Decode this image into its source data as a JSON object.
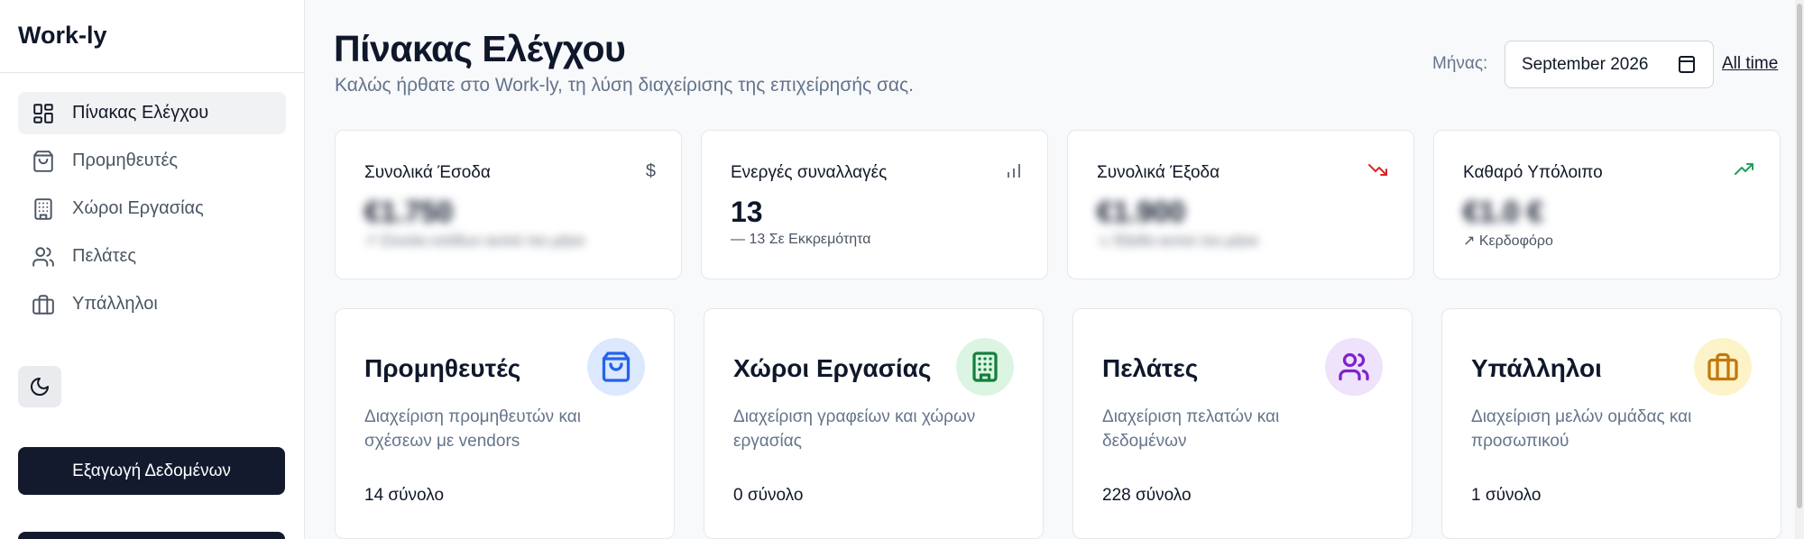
{
  "app": {
    "name": "Work-ly"
  },
  "sidebar": {
    "items": [
      {
        "label": "Πίνακας Ελέγχου",
        "icon": "dashboard-icon",
        "active": true
      },
      {
        "label": "Προμηθευτές",
        "icon": "shopping-bag-icon",
        "active": false
      },
      {
        "label": "Χώροι Εργασίας",
        "icon": "building-icon",
        "active": false
      },
      {
        "label": "Πελάτες",
        "icon": "users-icon",
        "active": false
      },
      {
        "label": "Υπάλληλοι",
        "icon": "briefcase-icon",
        "active": false
      }
    ],
    "theme_icon": "moon-icon",
    "export_label": "Εξαγωγή Δεδομένων"
  },
  "header": {
    "title": "Πίνακας Ελέγχου",
    "subtitle": "Καλώς ήρθατε στο Work-ly, τη λύση διαχείρισης της επιχείρησής σας.",
    "month_label": "Μήνας:",
    "month_value": "September 2026",
    "all_time_label": "All time"
  },
  "stats": [
    {
      "label": "Συνολικά Έσοδα",
      "icon": "dollar-icon",
      "value": "€1.750",
      "sub": "↗ Σύνολο εσόδων αυτού του μήνα",
      "sub_color": "#22a05a",
      "blurred": true
    },
    {
      "label": "Ενεργές συναλλαγές",
      "icon": "bar-chart-icon",
      "value": "13",
      "sub": "— 13 Σε Εκκρεμότητα",
      "sub_color": "#4b5563",
      "blurred": false
    },
    {
      "label": "Συνολικά Έξοδα",
      "icon": "trend-down-icon",
      "value": "€1.900",
      "sub": "↘ Έξοδα αυτού του μήνα",
      "sub_color": "#dc2626",
      "blurred": true
    },
    {
      "label": "Καθαρό Υπόλοιπο",
      "icon": "trend-up-icon",
      "value": "€1.0 €",
      "sub": "↗ Κερδοφόρο",
      "sub_color": "#22a05a",
      "blurred": true
    }
  ],
  "features": [
    {
      "title": "Προμηθευτές",
      "desc": "Διαχείριση προμηθευτών και σχέσεων με vendors",
      "count": "14 σύνολο",
      "icon": "shopping-bag-icon",
      "bg": "#dbe8fd",
      "fg": "#2563eb"
    },
    {
      "title": "Χώροι Εργασίας",
      "desc": "Διαχείριση γραφείων και χώρων εργασίας",
      "count": "0 σύνολο",
      "icon": "building-icon",
      "bg": "#dcf5e3",
      "fg": "#15803d"
    },
    {
      "title": "Πελάτες",
      "desc": "Διαχείριση πελατών και δεδομένων",
      "count": "228 σύνολο",
      "icon": "users-icon",
      "bg": "#efe2fb",
      "fg": "#7e22ce"
    },
    {
      "title": "Υπάλληλοι",
      "desc": "Διαχείριση μελών ομάδας και προσωπικού",
      "count": "1 σύνολο",
      "icon": "briefcase-icon",
      "bg": "#fdf3c9",
      "fg": "#c2790a"
    }
  ]
}
